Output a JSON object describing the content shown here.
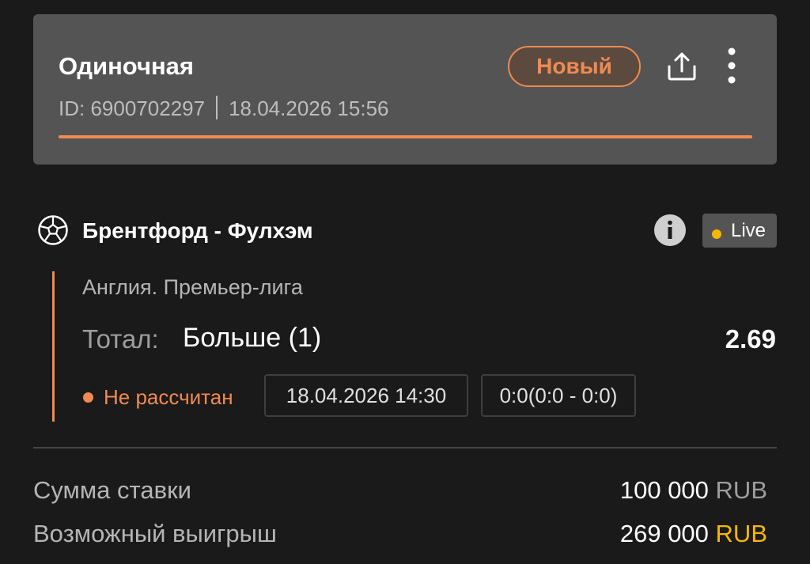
{
  "bet": {
    "type": "Одиночная",
    "status": "Новый",
    "id_label": "ID:",
    "id": "6900702297",
    "datetime": "18.04.2026 15:56"
  },
  "event": {
    "title": "Брентфорд - Фулхэм",
    "live_label": "Live",
    "league": "Англия. Премьер-лига",
    "market_label": "Тотал:",
    "market_value": "Больше (1)",
    "odds": "2.69",
    "settle_status": "Не рассчитан",
    "start_time": "18.04.2026 14:30",
    "score": "0:0(0:0 - 0:0)"
  },
  "summary": {
    "stake_label": "Сумма ставки",
    "stake_amount": "100 000",
    "stake_currency": "RUB",
    "win_label": "Возможный выигрыш",
    "win_amount": "269 000",
    "win_currency": "RUB"
  },
  "icons": {
    "share": "share-icon",
    "more": "more-vertical-icon",
    "sport": "soccer-ball-icon",
    "info": "info-icon"
  },
  "colors": {
    "accent": "#f08a52",
    "live_dot": "#f5b700",
    "currency_highlight": "#f5b700",
    "card_bg": "#545454",
    "page_bg": "#1a1a1a"
  }
}
